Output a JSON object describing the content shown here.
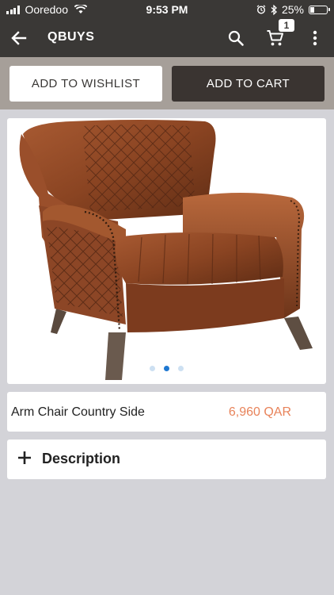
{
  "status_bar": {
    "carrier": "Ooredoo",
    "time": "9:53 PM",
    "battery": "25%",
    "battery_level": 0.25
  },
  "app_bar": {
    "title": "QBUYS",
    "cart_count": "1"
  },
  "actions": {
    "wishlist_label": "ADD TO WISHLIST",
    "cart_label": "ADD TO CART"
  },
  "product": {
    "name": "Arm Chair Country Side",
    "price": "6,960 QAR",
    "image_subject": "brown leather wingback armchair",
    "carousel": {
      "total": 3,
      "active_index": 1
    }
  },
  "description": {
    "label": "Description"
  },
  "colors": {
    "header_bg": "#3a3836",
    "action_strip_bg": "#a69f99",
    "page_bg": "#d3d3d8",
    "price": "#e8835a",
    "active_dot": "#1f78d1"
  }
}
